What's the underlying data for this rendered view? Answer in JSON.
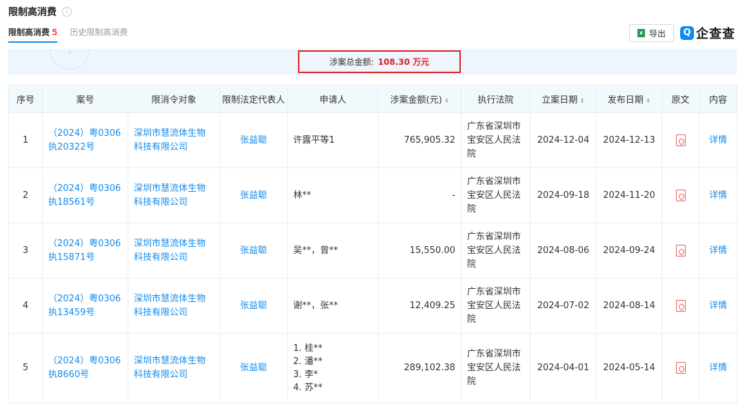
{
  "header": {
    "title": "限制高消费",
    "info_icon": "info-icon"
  },
  "tabs": [
    {
      "label": "限制高消费",
      "count": "5",
      "active": true
    },
    {
      "label": "历史限制高消费",
      "count": "",
      "active": false
    }
  ],
  "toolbar": {
    "export_label": "导出",
    "export_icon": "excel-icon"
  },
  "brand": {
    "logo_glyph": "Q",
    "name": "企查查",
    "color": "#128bed"
  },
  "summary": {
    "stamp": "¥",
    "label": "涉案总金额:",
    "value": "108.30 万元",
    "highlight_color": "#e02020"
  },
  "table": {
    "columns": [
      "序号",
      "案号",
      "限消令对象",
      "限制法定代表人",
      "申请人",
      "涉案金额(元)",
      "执行法院",
      "立案日期",
      "发布日期",
      "原文",
      "内容"
    ],
    "rows": [
      {
        "index": "1",
        "case_no": "（2024）粤0306执20322号",
        "target": "深圳市慧流体生物科技有限公司",
        "legal_rep": "张益聪",
        "applicants": [
          "许露平等1"
        ],
        "amount": "765,905.32",
        "court": "广东省深圳市宝安区人民法院",
        "filed": "2024-12-04",
        "published": "2024-12-13",
        "detail": "详情"
      },
      {
        "index": "2",
        "case_no": "（2024）粤0306执18561号",
        "target": "深圳市慧流体生物科技有限公司",
        "legal_rep": "张益聪",
        "applicants": [
          "林**"
        ],
        "amount": "-",
        "court": "广东省深圳市宝安区人民法院",
        "filed": "2024-09-18",
        "published": "2024-11-20",
        "detail": "详情"
      },
      {
        "index": "3",
        "case_no": "（2024）粤0306执15871号",
        "target": "深圳市慧流体生物科技有限公司",
        "legal_rep": "张益聪",
        "applicants": [
          "吴**，曾**"
        ],
        "amount": "15,550.00",
        "court": "广东省深圳市宝安区人民法院",
        "filed": "2024-08-06",
        "published": "2024-09-24",
        "detail": "详情"
      },
      {
        "index": "4",
        "case_no": "（2024）粤0306执13459号",
        "target": "深圳市慧流体生物科技有限公司",
        "legal_rep": "张益聪",
        "applicants": [
          "谢**，张**"
        ],
        "amount": "12,409.25",
        "court": "广东省深圳市宝安区人民法院",
        "filed": "2024-07-02",
        "published": "2024-08-14",
        "detail": "详情"
      },
      {
        "index": "5",
        "case_no": "（2024）粤0306执8660号",
        "target": "深圳市慧流体生物科技有限公司",
        "legal_rep": "张益聪",
        "applicants": [
          "1. 桂**",
          "2. 潘**",
          "3. 李*",
          "4. 苏**"
        ],
        "amount": "289,102.38",
        "court": "广东省深圳市宝安区人民法院",
        "filed": "2024-04-01",
        "published": "2024-05-14",
        "detail": "详情"
      }
    ]
  }
}
